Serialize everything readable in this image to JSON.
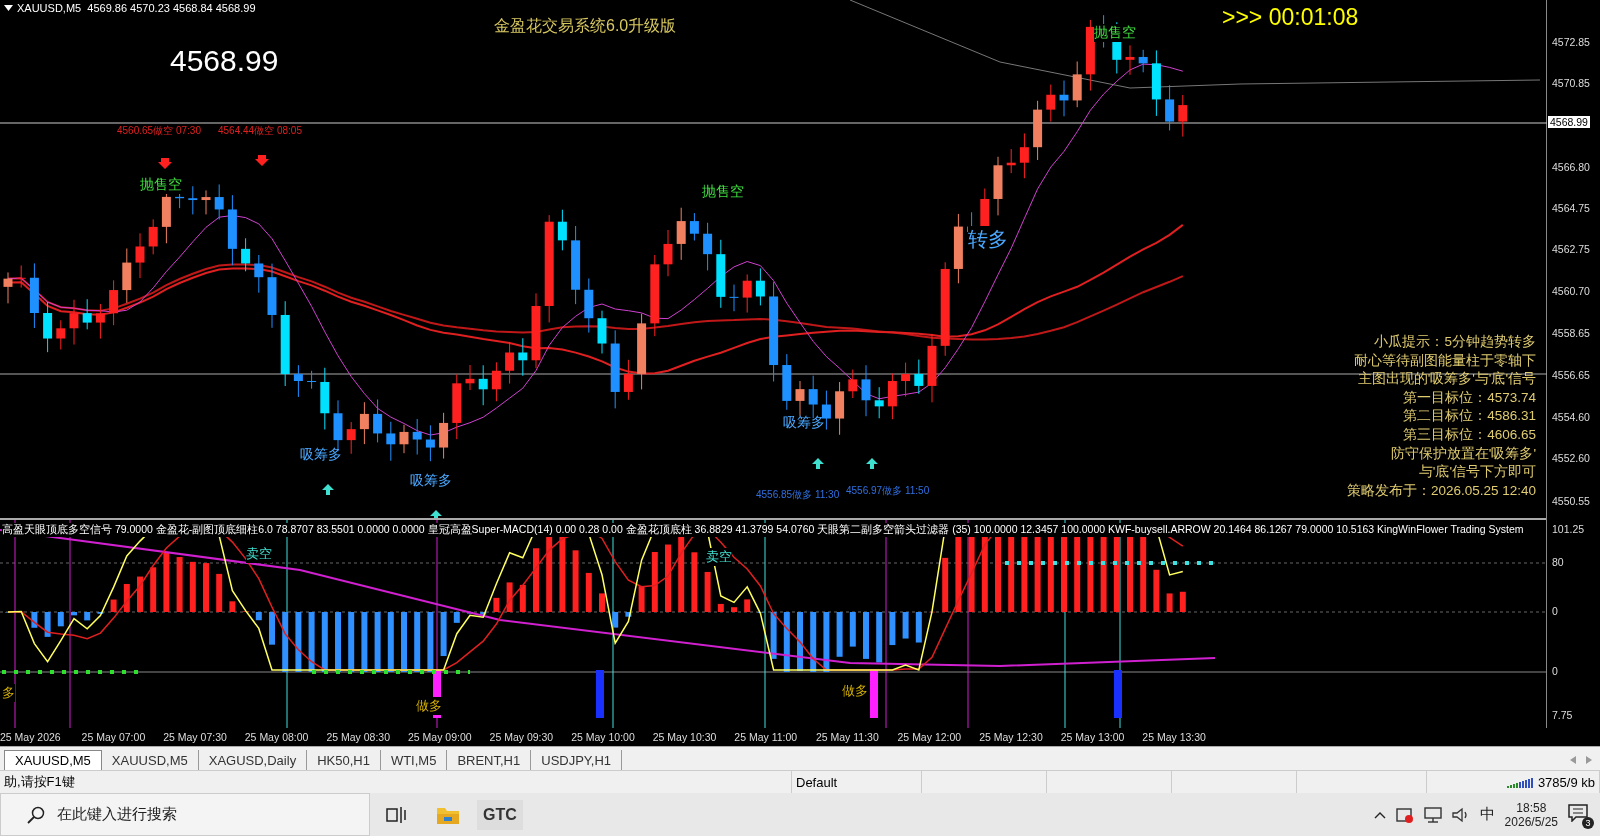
{
  "chart": {
    "symbol_header": "XAUUSD,M5  4569.86 4570.23 4568.84 4568.99",
    "title": "金盈花交易系统6.0升级版",
    "countdown": ">>> 00:01:08",
    "last_price": "4568.99",
    "annotations": [
      {
        "kind": "short",
        "text": "4560.65做空 07:30"
      },
      {
        "kind": "short",
        "text": "4564.44做空 08:05"
      },
      {
        "kind": "sell",
        "text": "抛售空"
      },
      {
        "kind": "sell",
        "text": "抛售空"
      },
      {
        "kind": "sell",
        "text": "抛售空"
      },
      {
        "kind": "buy",
        "text": "吸筹多"
      },
      {
        "kind": "buy",
        "text": "吸筹多"
      },
      {
        "kind": "buy",
        "text": "吸筹多"
      },
      {
        "kind": "trend",
        "text": "转多"
      },
      {
        "kind": "long",
        "text": "4556.85做多 11:30"
      },
      {
        "kind": "long",
        "text": "4556.97做多 11:50"
      }
    ],
    "info_panel": [
      "小瓜提示：5分钟趋势转多",
      "耐心等待副图能量柱于零轴下",
      "主图出现的'吸筹多'与'底'信号",
      "第一目标位：4573.74",
      "第二目标位：4586.31",
      "第三目标位：4606.65",
      "防守保护放置在'吸筹多'",
      "与'底'信号下方即可",
      "策略发布于：2026.05.25 12:40"
    ]
  },
  "price_axis": {
    "labels": [
      "4572.85",
      "4570.85",
      "4566.80",
      "4564.75",
      "4562.75",
      "4560.70",
      "4558.65",
      "4556.65",
      "4554.60",
      "4552.60",
      "4550.55"
    ],
    "current_price": "4568.99"
  },
  "indicator": {
    "header": "高盈天眼顶底多空信号 79.0000  金盈花-副图顶底细柱6.0 78.8707 83.5501 0.0000 0.0000  皇冠高盈Super-MACD(14) 0.00 0.28 0.00  金盈花顶底柱 36.8829 41.3799 54.0760  天眼第二副多空箭头过滤器 (35) 100.0000 12.3457 100.0000  KWF-buysell.ARROW 20.1464 86.1267 79.0000 10.5163  KingWinFlower Trading System",
    "labels": [
      {
        "kind": "sell",
        "text": "卖空"
      },
      {
        "kind": "sell",
        "text": "卖空"
      },
      {
        "kind": "buy",
        "text": "做多"
      },
      {
        "kind": "buy",
        "text": "做多"
      },
      {
        "kind": "buy",
        "text": "多"
      }
    ],
    "axis_labels": [
      "101.25",
      "80",
      "0",
      "0",
      "7.75"
    ]
  },
  "time_axis": [
    "25 May 2026",
    "25 May 07:00",
    "25 May 07:30",
    "25 May 08:00",
    "25 May 08:30",
    "25 May 09:00",
    "25 May 09:30",
    "25 May 10:00",
    "25 May 10:30",
    "25 May 11:00",
    "25 May 11:30",
    "25 May 12:00",
    "25 May 12:30",
    "25 May 13:00",
    "25 May 13:30"
  ],
  "tabs": [
    {
      "label": "XAUUSD,M5",
      "selected": true
    },
    {
      "label": "XAUUSD,M5",
      "selected": false
    },
    {
      "label": "XAGUSD,Daily",
      "selected": false
    },
    {
      "label": "HK50,H1",
      "selected": false
    },
    {
      "label": "WTI,M5",
      "selected": false
    },
    {
      "label": "BRENT,H1",
      "selected": false
    },
    {
      "label": "USDJPY,H1",
      "selected": false
    }
  ],
  "status_bar": {
    "help": "助,请按F1键",
    "profile": "Default",
    "traffic": "3785/9 kb"
  },
  "taskbar": {
    "search_placeholder": "在此键入进行搜索",
    "app_label": "GTC",
    "ime": "中",
    "time": "18:58",
    "date": "2026/5/25",
    "notifications": "3"
  }
}
